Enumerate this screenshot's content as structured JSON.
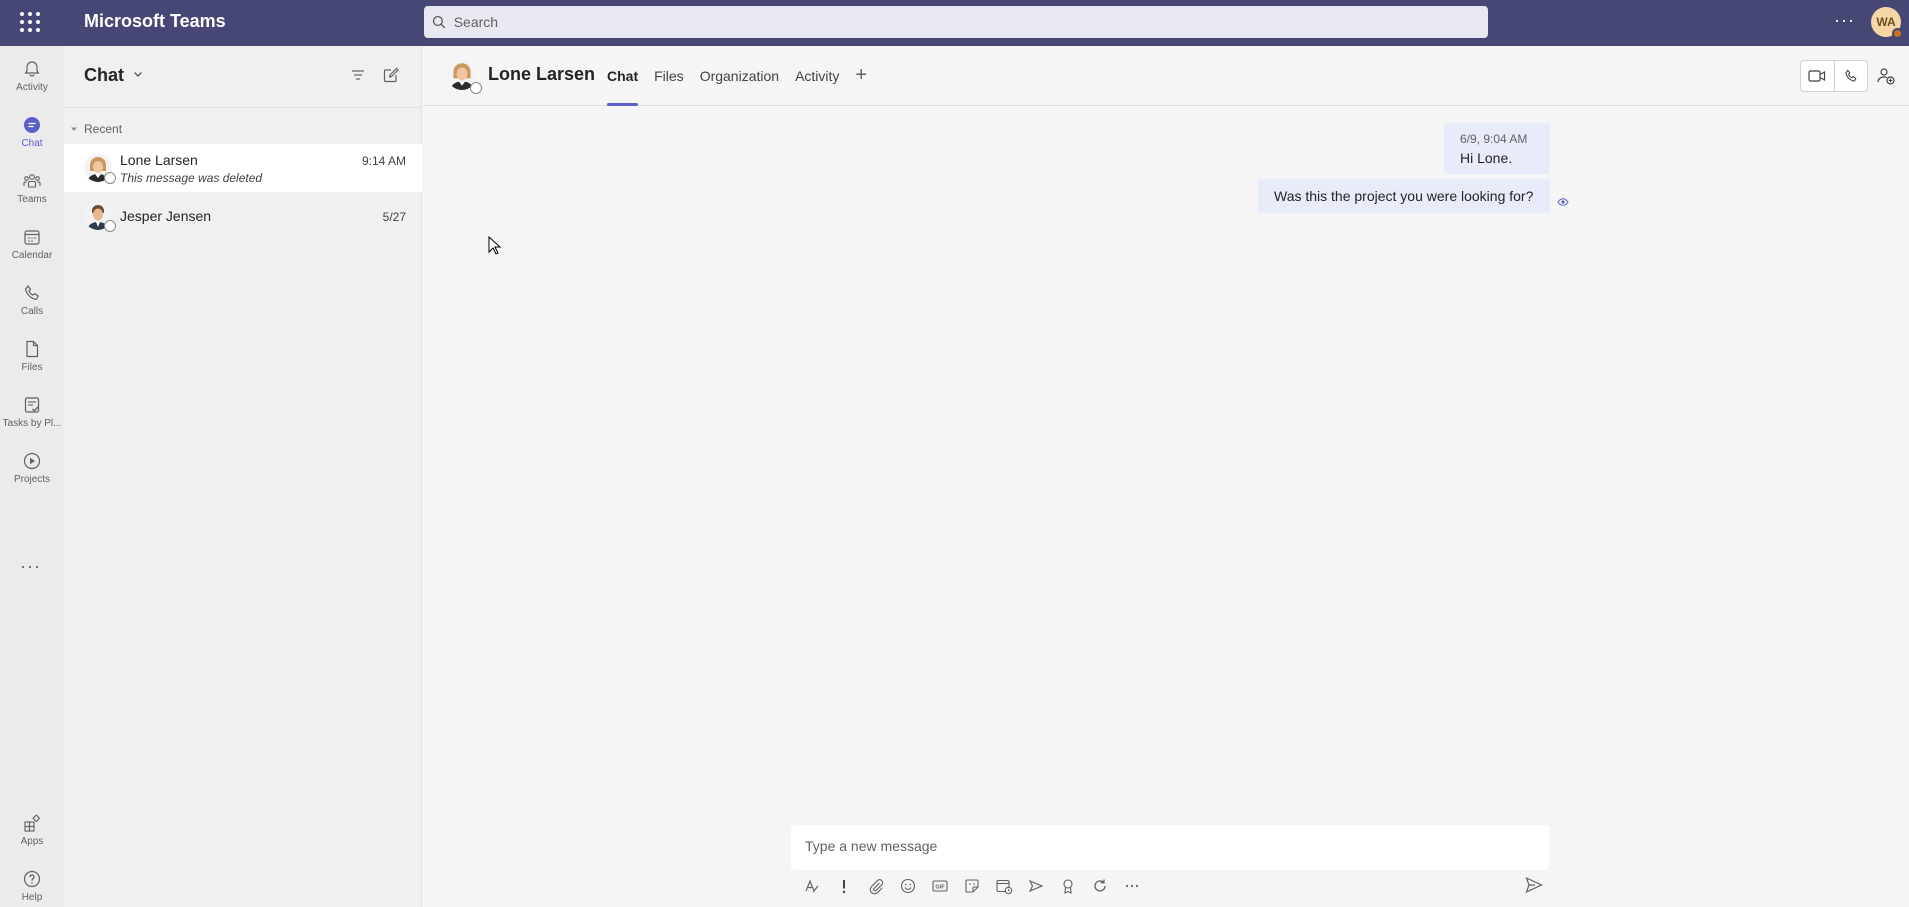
{
  "titlebar": {
    "app_title": "Microsoft Teams",
    "search_placeholder": "Search",
    "more_label": "···",
    "user_initials": "WA"
  },
  "rail": {
    "items": [
      {
        "label": "Activity",
        "icon": "bell-icon"
      },
      {
        "label": "Chat",
        "icon": "chat-icon"
      },
      {
        "label": "Teams",
        "icon": "teams-icon"
      },
      {
        "label": "Calendar",
        "icon": "calendar-icon"
      },
      {
        "label": "Calls",
        "icon": "phone-icon"
      },
      {
        "label": "Files",
        "icon": "file-icon"
      },
      {
        "label": "Tasks by Pl...",
        "icon": "tasks-icon"
      },
      {
        "label": "Projects",
        "icon": "projects-icon"
      }
    ],
    "more_label": "···",
    "bottom": [
      {
        "label": "Apps",
        "icon": "apps-icon"
      },
      {
        "label": "Help",
        "icon": "help-icon"
      }
    ]
  },
  "chat_list": {
    "title": "Chat",
    "section": "Recent",
    "chats": [
      {
        "name": "Lone Larsen",
        "preview": "This message was deleted",
        "time": "9:14 AM"
      },
      {
        "name": "Jesper Jensen",
        "preview": "",
        "time": "5/27"
      }
    ]
  },
  "conversation": {
    "name": "Lone Larsen",
    "tabs": [
      "Chat",
      "Files",
      "Organization",
      "Activity"
    ],
    "add_tab": "+",
    "messages": [
      {
        "timestamp": "6/9, 9:04 AM",
        "text": "Hi Lone."
      },
      {
        "text": "Was this the project you were looking for?"
      }
    ],
    "compose_placeholder": "Type a new message"
  },
  "colors": {
    "titlebar": "#464775",
    "accent": "#5b5fc7",
    "bubble": "#e8ebfa"
  }
}
